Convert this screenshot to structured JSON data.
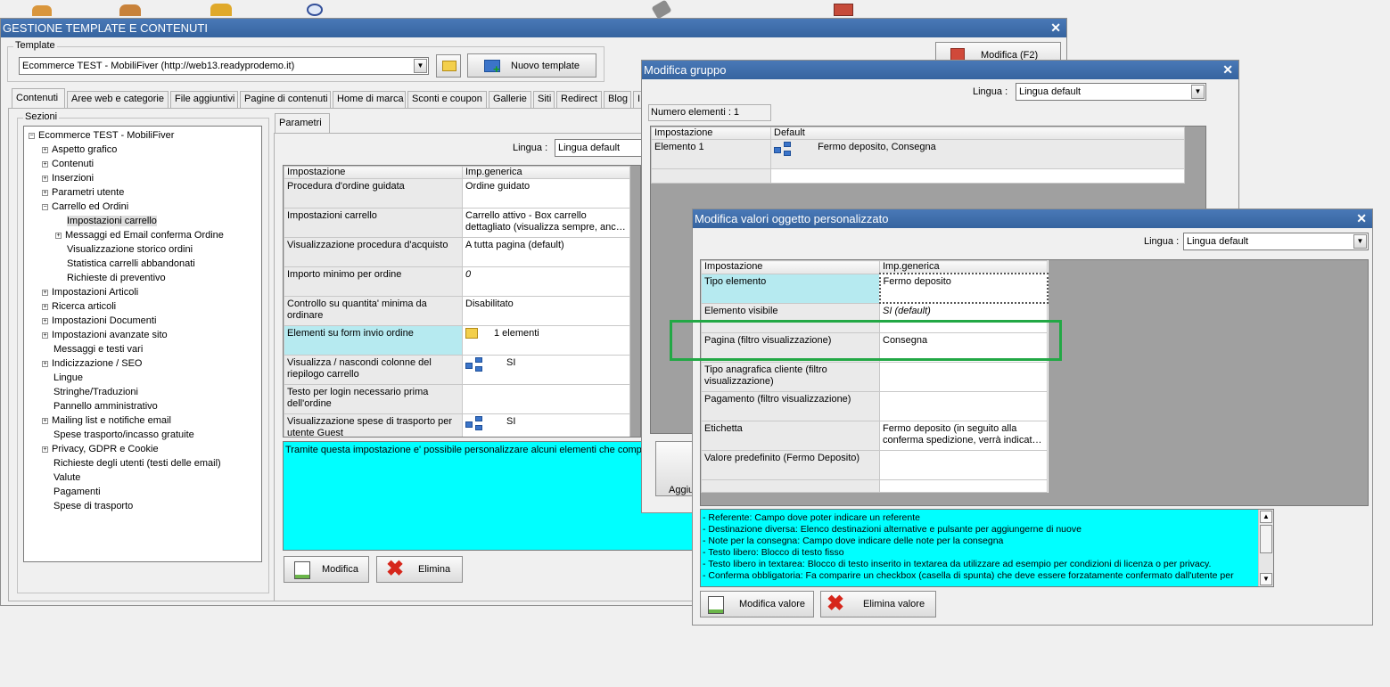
{
  "main_window": {
    "title": "GESTIONE TEMPLATE E CONTENUTI",
    "template_group_label": "Template",
    "template_value": "Ecommerce TEST - MobiliFiver (http://web13.readyprodemo.it)",
    "new_template_label": "Nuovo template",
    "top_right_button_label": "Modifica (F2)",
    "tabs": [
      "Contenuti",
      "Aree web e categorie",
      "File aggiuntivi",
      "Pagine di contenuti",
      "Home di marca",
      "Sconti e coupon",
      "Gallerie",
      "Siti",
      "Redirect",
      "Blog",
      "I"
    ],
    "sections_label": "Sezioni",
    "tree": {
      "root": "Ecommerce TEST - MobiliFiver",
      "items": [
        {
          "label": "Aspetto grafico",
          "expander": "+",
          "level": 1
        },
        {
          "label": "Contenuti",
          "expander": "+",
          "level": 1
        },
        {
          "label": "Inserzioni",
          "expander": "+",
          "level": 1
        },
        {
          "label": "Parametri utente",
          "expander": "+",
          "level": 1
        },
        {
          "label": "Carrello ed Ordini",
          "expander": "-",
          "level": 1
        },
        {
          "label": "Impostazioni carrello",
          "expander": "",
          "level": 2
        },
        {
          "label": "Messaggi ed Email conferma Ordine",
          "expander": "+",
          "level": 2
        },
        {
          "label": "Visualizzazione storico ordini",
          "expander": "",
          "level": 2
        },
        {
          "label": "Statistica carrelli abbandonati",
          "expander": "",
          "level": 2
        },
        {
          "label": "Richieste di preventivo",
          "expander": "",
          "level": 2
        },
        {
          "label": "Impostazioni Articoli",
          "expander": "+",
          "level": 1
        },
        {
          "label": "Ricerca articoli",
          "expander": "+",
          "level": 1
        },
        {
          "label": "Impostazioni Documenti",
          "expander": "+",
          "level": 1
        },
        {
          "label": "Impostazioni avanzate sito",
          "expander": "+",
          "level": 1
        },
        {
          "label": "Messaggi e testi vari",
          "expander": "",
          "level": 1
        },
        {
          "label": "Indicizzazione / SEO",
          "expander": "+",
          "level": 1
        },
        {
          "label": "Lingue",
          "expander": "",
          "level": 1
        },
        {
          "label": "Stringhe/Traduzioni",
          "expander": "",
          "level": 1
        },
        {
          "label": "Pannello amministrativo",
          "expander": "",
          "level": 1
        },
        {
          "label": "Mailing list e notifiche email",
          "expander": "+",
          "level": 1
        },
        {
          "label": "Spese trasporto/incasso gratuite",
          "expander": "",
          "level": 1
        },
        {
          "label": "Privacy, GDPR e Cookie",
          "expander": "+",
          "level": 1
        },
        {
          "label": "Richieste degli utenti (testi delle email)",
          "expander": "",
          "level": 1
        },
        {
          "label": "Valute",
          "expander": "",
          "level": 1
        },
        {
          "label": "Pagamenti",
          "expander": "",
          "level": 1
        },
        {
          "label": "Spese di trasporto",
          "expander": "",
          "level": 1
        }
      ]
    },
    "params_tab_label": "Parametri",
    "lingua_label": "Lingua :",
    "lingua_value": "Lingua default",
    "grid_headers": [
      "Impostazione",
      "Imp.generica"
    ],
    "grid_rows": [
      {
        "key": "Procedura d'ordine guidata",
        "value": "Ordine guidato",
        "icon": ""
      },
      {
        "key": "Impostazioni carrello",
        "value": "Carrello attivo - Box carrello dettagliato (visualizza sempre, anc…",
        "icon": ""
      },
      {
        "key": "Visualizzazione procedura d'acquisto",
        "value": "A tutta pagina (default)",
        "icon": ""
      },
      {
        "key": "Importo minimo per ordine",
        "value": "0",
        "icon": ""
      },
      {
        "key": "Controllo su quantita' minima da ordinare",
        "value": "Disabilitato",
        "icon": ""
      },
      {
        "key": "Elementi su form invio ordine",
        "value": "1 elementi",
        "icon": "folder"
      },
      {
        "key": "Visualizza / nascondi colonne del riepilogo carrello",
        "value": "SI",
        "icon": "tree"
      },
      {
        "key": "Testo per login necessario prima dell'ordine",
        "value": "",
        "icon": ""
      },
      {
        "key": "Visualizzazione spese di trasporto per utente Guest",
        "value": "SI",
        "icon": "tree"
      }
    ],
    "info_text": "Tramite questa impostazione e' possibile personalizzare alcuni elementi che compongono",
    "modifica_label": "Modifica",
    "elimina_label": "Elimina"
  },
  "group_window": {
    "title": "Modifica gruppo",
    "lingua_label": "Lingua :",
    "lingua_value": "Lingua default",
    "count_label": "Numero elementi : 1",
    "headers": [
      "Impostazione",
      "Default"
    ],
    "rows": [
      {
        "key": "Elemento 1",
        "value": "Fermo deposito, Consegna"
      }
    ],
    "partial_button_label": "Aggiu"
  },
  "custom_window": {
    "title": "Modifica valori oggetto personalizzato",
    "lingua_label": "Lingua :",
    "lingua_value": "Lingua default",
    "headers": [
      "Impostazione",
      "Imp.generica"
    ],
    "rows": [
      {
        "key": "Tipo elemento",
        "value": "Fermo deposito",
        "italic": false
      },
      {
        "key": "Elemento visibile",
        "value": "SI (default)",
        "italic": true
      },
      {
        "key": "Pagina (filtro visualizzazione)",
        "value": "Consegna",
        "italic": false
      },
      {
        "key": "Tipo anagrafica cliente (filtro visualizzazione)",
        "value": "",
        "italic": false
      },
      {
        "key": "Pagamento (filtro visualizzazione)",
        "value": "",
        "italic": false
      },
      {
        "key": "Etichetta",
        "value": "Fermo deposito (in seguito alla conferma spedizione, verrà indicat…",
        "italic": false
      },
      {
        "key": "Valore predefinito (Fermo Deposito)",
        "value": "",
        "italic": false
      }
    ],
    "info_lines": [
      "- Referente: Campo dove poter indicare un referente",
      "- Destinazione diversa: Elenco destinazioni alternative e pulsante per aggiungerne di nuove",
      "- Note per la consegna: Campo dove indicare delle note per la consegna",
      "- Testo libero: Blocco di testo fisso",
      "- Testo libero in textarea: Blocco di testo inserito in textarea da utilizzare ad esempio per condizioni di licenza o per privacy.",
      "- Conferma obbligatoria: Fa comparire un checkbox (casella di spunta) che deve essere forzatamente confermato dall'utente per"
    ],
    "modifica_valore_label": "Modifica valore",
    "elimina_valore_label": "Elimina valore"
  },
  "colors": {
    "title_bar": "#3f6fad",
    "highlight_box": "#22a845",
    "info_background": "#00ffff",
    "selected_row": "#b6eaf0"
  }
}
